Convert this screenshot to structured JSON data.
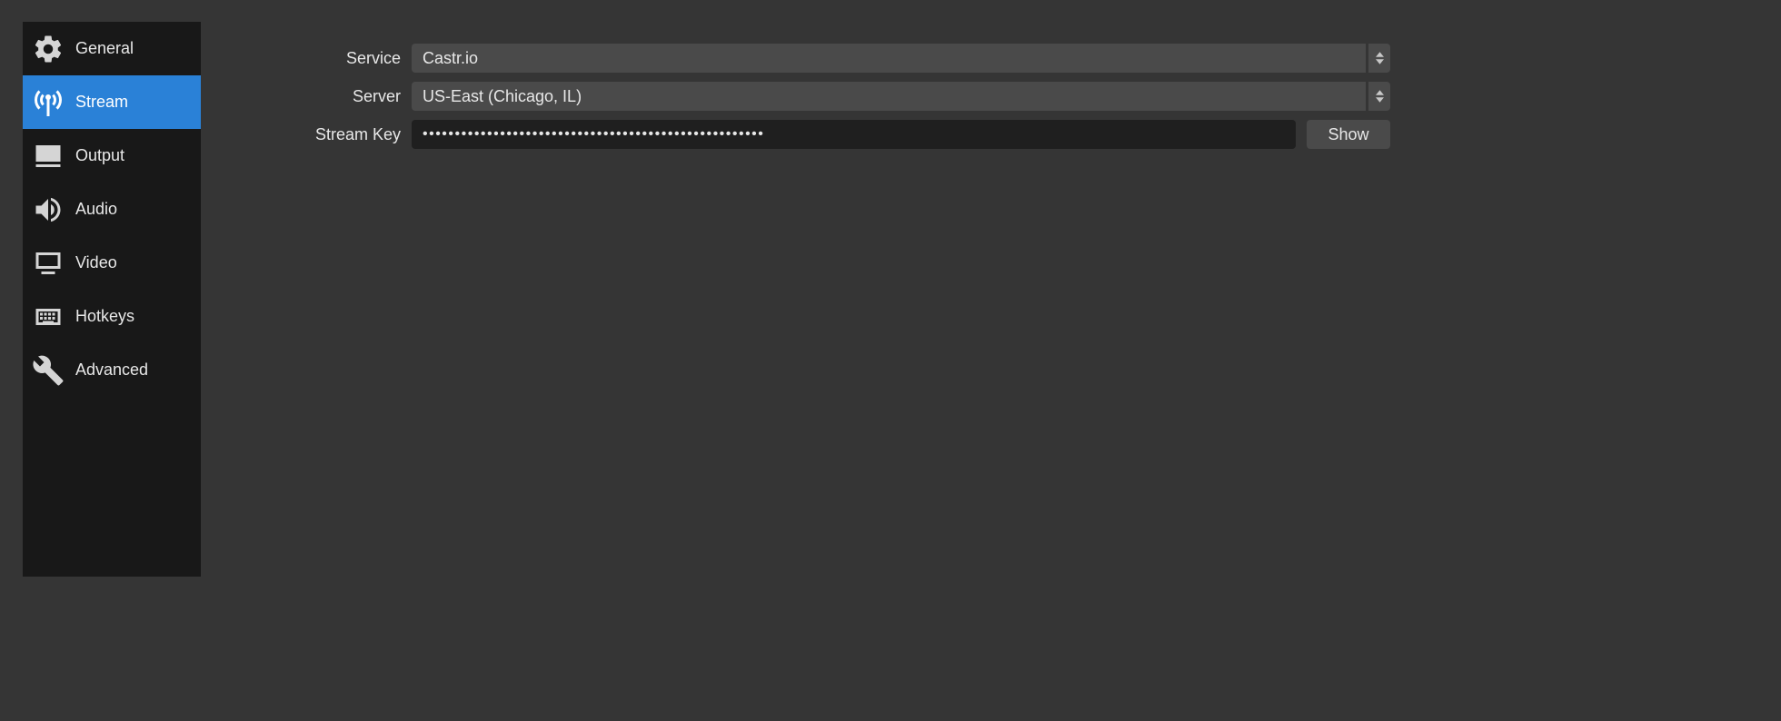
{
  "sidebar": {
    "items": [
      {
        "label": "General"
      },
      {
        "label": "Stream"
      },
      {
        "label": "Output"
      },
      {
        "label": "Audio"
      },
      {
        "label": "Video"
      },
      {
        "label": "Hotkeys"
      },
      {
        "label": "Advanced"
      }
    ],
    "active_index": 1
  },
  "form": {
    "service_label": "Service",
    "service_value": "Castr.io",
    "server_label": "Server",
    "server_value": "US-East (Chicago, IL)",
    "streamkey_label": "Stream Key",
    "streamkey_value": "•••••••••••••••••••••••••••••••••••••••••••••••••••••",
    "show_button": "Show"
  }
}
